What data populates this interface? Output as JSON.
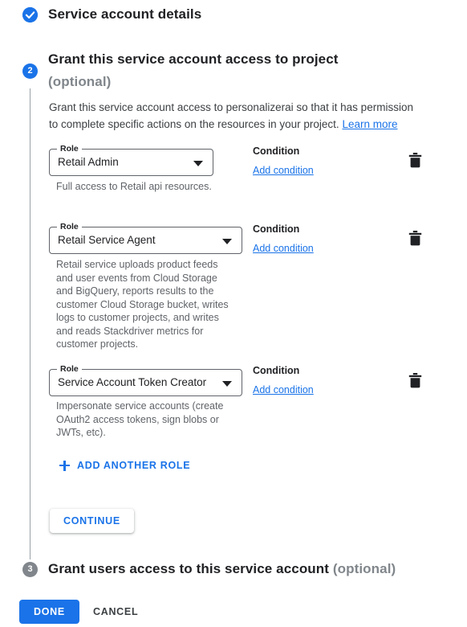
{
  "steps": {
    "step1": {
      "label": "Service account details",
      "state": "done",
      "icon": "check-circle-icon"
    },
    "step2": {
      "number": "2",
      "label": "Grant this service account access to project",
      "optional": "(optional)",
      "description_part1": "Grant this service account access to personalizerai so that it has permission to complete specific actions on the resources in your project.",
      "learn_more": "Learn more"
    },
    "step3": {
      "number": "3",
      "label": "Grant users access to this service account",
      "optional": "(optional)"
    }
  },
  "roles": [
    {
      "field_label": "Role",
      "value": "Retail Admin",
      "description": "Full access to Retail api resources.",
      "condition_label": "Condition",
      "condition_link": "Add condition",
      "delete_icon": "trash-icon"
    },
    {
      "field_label": "Role",
      "value": "Retail Service Agent",
      "description": "Retail service uploads product feeds and user events from Cloud Storage and BigQuery, reports results to the customer Cloud Storage bucket, writes logs to customer projects, and writes and reads Stackdriver metrics for customer projects.",
      "condition_label": "Condition",
      "condition_link": "Add condition",
      "delete_icon": "trash-icon"
    },
    {
      "field_label": "Role",
      "value": "Service Account Token Creator",
      "description": "Impersonate service accounts (create OAuth2 access tokens, sign blobs or JWTs, etc).",
      "condition_label": "Condition",
      "condition_link": "Add condition",
      "delete_icon": "trash-icon"
    }
  ],
  "actions": {
    "add_another_role": "ADD ANOTHER ROLE",
    "add_role_icon": "plus-icon",
    "continue": "CONTINUE",
    "done": "DONE",
    "cancel": "CANCEL"
  },
  "colors": {
    "accent": "#1a73e8",
    "pending_badge": "#80868b",
    "muted_text": "#5f6368",
    "body_text": "#3c4043"
  }
}
